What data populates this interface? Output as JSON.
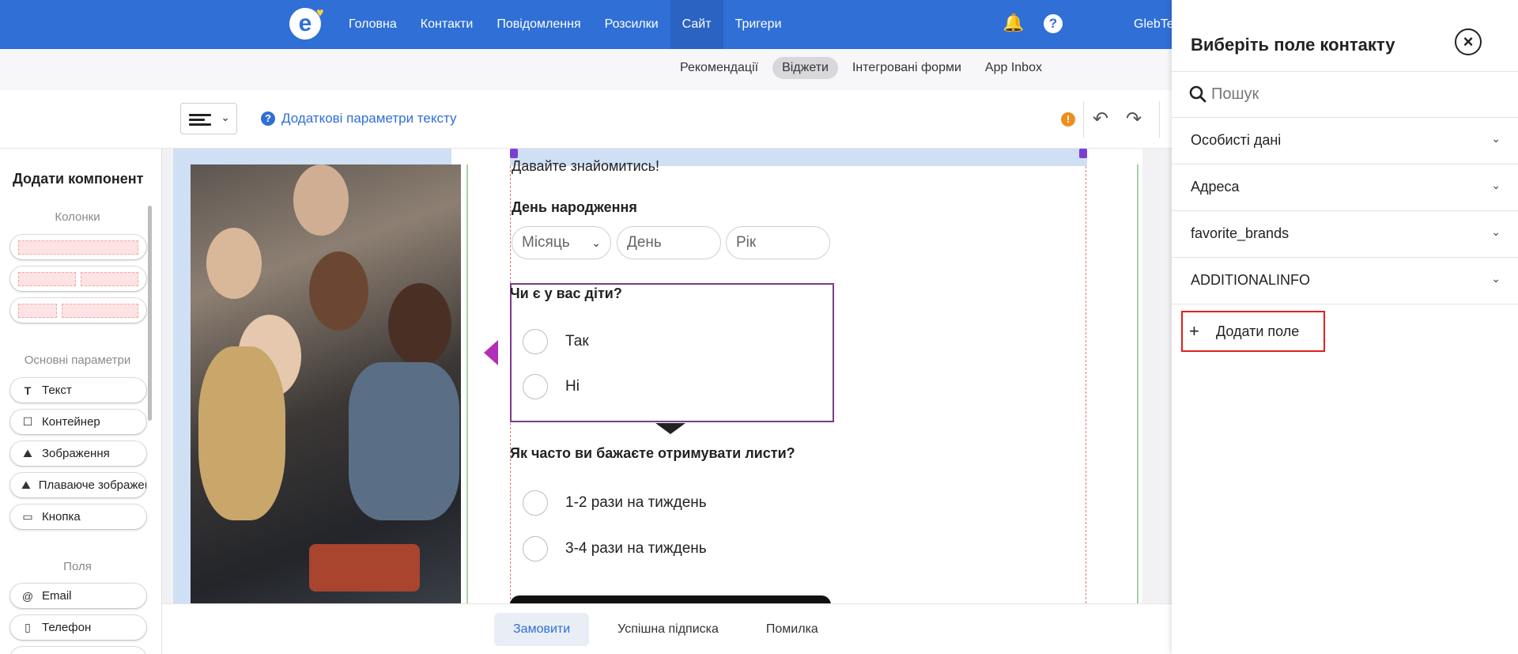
{
  "topnav": {
    "logo": "e",
    "items": [
      "Головна",
      "Контакти",
      "Повідомлення",
      "Розсилки",
      "Сайт",
      "Тригери"
    ],
    "active_index": 4,
    "user": "GlebTe"
  },
  "subnav": {
    "items": [
      "Рекомендації",
      "Віджети",
      "Інтегровані форми",
      "App Inbox"
    ],
    "active_index": 1
  },
  "toolbar": {
    "more_params": "Додаткові параметри тексту"
  },
  "sidebar": {
    "title": "Додати компонент",
    "columns_section": "Колонки",
    "basic_section": "Основні параметри",
    "basic_items": [
      "Текст",
      "Контейнер",
      "Зображення",
      "Плаваюче зображення",
      "Кнопка"
    ],
    "fields_section": "Поля",
    "field_items": [
      "Email",
      "Телефон"
    ]
  },
  "form": {
    "intro_text": "Давайте знайомитись!",
    "birthday_label": "День народження",
    "month_placeholder": "Місяць",
    "day_placeholder": "День",
    "year_placeholder": "Рік",
    "q1": "Чи є у вас діти?",
    "q1_options": [
      "Так",
      "Ні"
    ],
    "q2": "Як часто ви бажаєте отримувати листи?",
    "q2_options": [
      "1-2 рази на тиждень",
      "3-4 рази на тиждень"
    ]
  },
  "bottom_tabs": {
    "items": [
      "Замовити",
      "Успішна підписка",
      "Помилка"
    ],
    "active_index": 0
  },
  "right_panel": {
    "title": "Виберіть поле контакту",
    "search_placeholder": "Пошук",
    "groups": [
      "Особисті дані",
      "Адреса",
      "favorite_brands",
      "ADDITIONALINFO"
    ],
    "add_field": "Додати поле"
  },
  "colors": {
    "brand_blue": "#2f6fd6",
    "selection_purple": "#7b3a8e",
    "warning_orange": "#ec8f1f",
    "highlight_red": "#e02020"
  }
}
